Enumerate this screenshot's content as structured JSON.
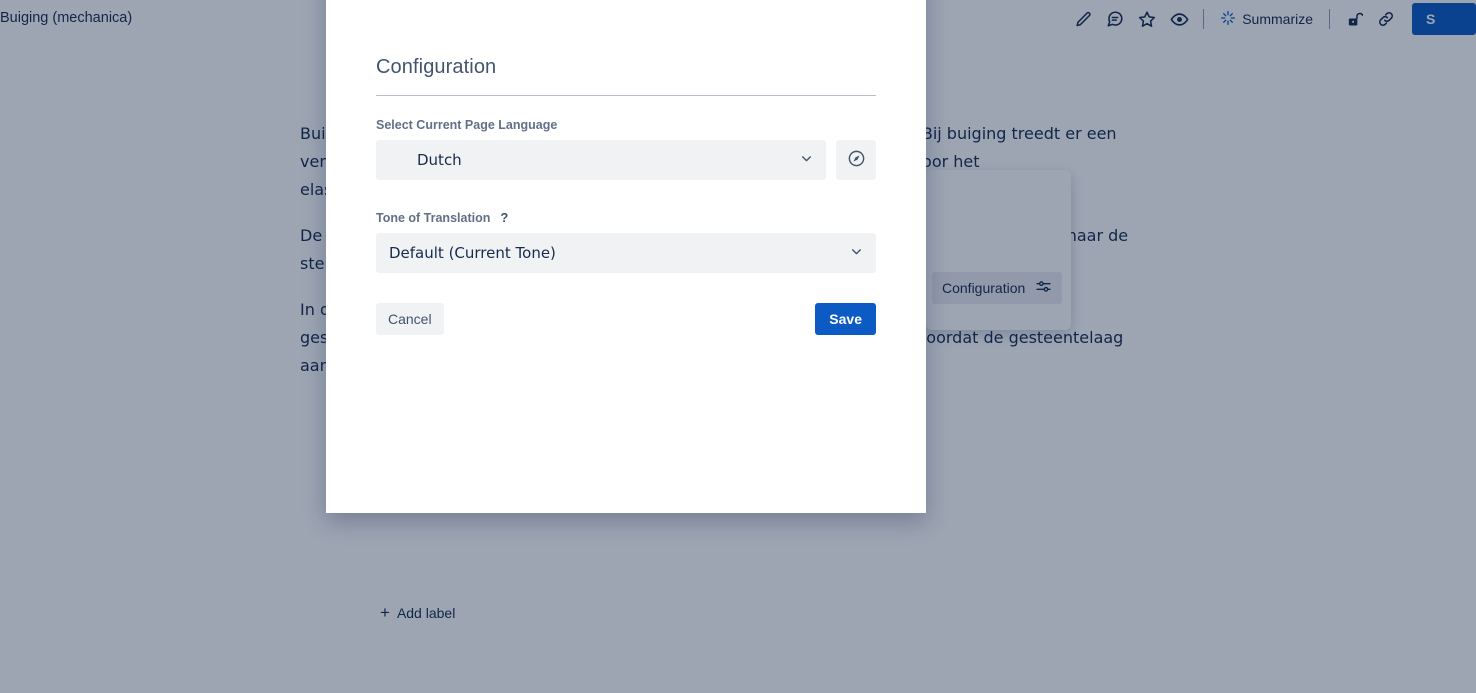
{
  "background": {
    "breadcrumb": "Buiging (mechanica)",
    "toolbar": {
      "icons": [
        {
          "name": "edit-icon",
          "glyph": "pencil"
        },
        {
          "name": "comment-icon",
          "glyph": "comment"
        },
        {
          "name": "star-icon",
          "glyph": "star"
        },
        {
          "name": "watch-icon",
          "glyph": "eye"
        }
      ],
      "summarize_label": "Summarize",
      "right_icons": [
        {
          "name": "restrictions-icon",
          "glyph": "unlock"
        },
        {
          "name": "copy-link-icon",
          "glyph": "link"
        }
      ],
      "share_label": "S"
    },
    "popup": {
      "item_label": "Configuration"
    },
    "paragraphs": [
      "Buiging is een vervorming van een constructiedeel loodrecht op de lange as. Bij buiging treedt er een vervorming op van de lange as. De weerstand tegen buiging wordt bepaald door het elasticiteitsmodulus en het oppervlaktetraagheidsmoment.",
      "De weerstand van materialen tegen het optreden van buiging wordt bepaald bij het onderzoek naar de sterkte van materialen met een buigproef.",
      "In de geologie wordt onder buiging een verbuiging in diepterichting (de Aarde in) van een gesteentelaag verstaan, waarbij deze naar beneden wordt gedrukt, meestal doordat de gesteentelaag aan een breuk is verbonden. Vaak treedt na"
    ],
    "add_label": "Add label"
  },
  "modal": {
    "title": "Configuration",
    "language_field": {
      "label": "Select Current Page Language",
      "value": "Dutch",
      "flag": "nl-flag-icon",
      "compass_button": "detect-language-button"
    },
    "tone_field": {
      "label": "Tone of Translation",
      "help": "?",
      "value": "Default (Current Tone)"
    },
    "cancel_label": "Cancel",
    "save_label": "Save"
  },
  "colors": {
    "primary": "#0c5bc4",
    "overlay": "rgba(9,30,66,0.40)",
    "field_bg": "#f1f2f4",
    "text": "#172b4d",
    "label": "#626f86"
  }
}
